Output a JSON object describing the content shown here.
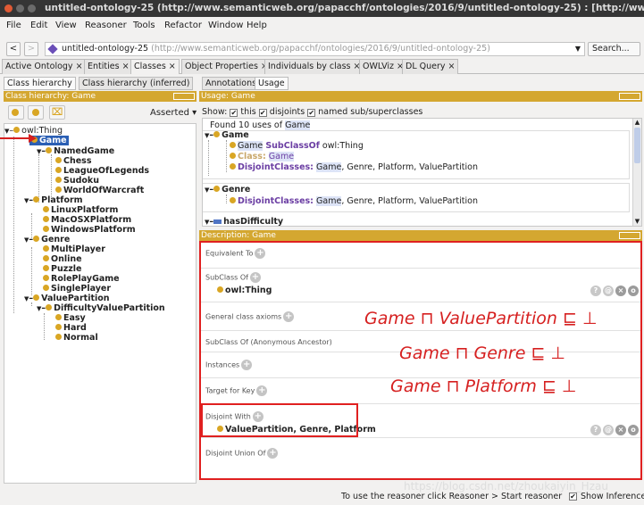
{
  "window": {
    "title": "untitled-ontology-25 (http://www.semanticweb.org/papacchf/ontologies/2016/9/untitled-ontology-25) : [http://www.semanticweb."
  },
  "menu": [
    "File",
    "Edit",
    "View",
    "Reasoner",
    "Tools",
    "Refactor",
    "Window",
    "Help"
  ],
  "urlbar": {
    "back": "<",
    "forward": ">",
    "ontology": "untitled-ontology-25",
    "iri": "(http://www.semanticweb.org/papacchf/ontologies/2016/9/untitled-ontology-25)",
    "search": "Search..."
  },
  "tabs": [
    "Active Ontology ×",
    "Entities ×",
    "Classes ×",
    "Object Properties ×",
    "Individuals by class ×",
    "OWLViz ×",
    "DL Query ×"
  ],
  "left": {
    "subtabs": [
      "Class hierarchy",
      "Class hierarchy (inferred)"
    ],
    "header": "Class hierarchy: Game",
    "asserted": "Asserted ▾",
    "tree": [
      "owl:Thing",
      "Game",
      "NamedGame",
      "Chess",
      "LeagueOfLegends",
      "Sudoku",
      "WorldOfWarcraft",
      "Platform",
      "LinuxPlatform",
      "MacOSXPlatform",
      "WindowsPlatform",
      "Genre",
      "MultiPlayer",
      "Online",
      "Puzzle",
      "RolePlayGame",
      "SinglePlayer",
      "ValuePartition",
      "DifficultyValuePartition",
      "Easy",
      "Hard",
      "Normal"
    ]
  },
  "right": {
    "subtabs": [
      "Annotations",
      "Usage"
    ],
    "usage_header": "Usage: Game",
    "show": "Show:",
    "opt_this": "this",
    "opt_disjoints": "disjoints",
    "opt_named": "named sub/superclasses",
    "found_prefix": "Found 10 uses of",
    "found_name": "Game",
    "usage": {
      "game": "Game",
      "l1_a": "Game",
      "l1_b": "SubClassOf",
      "l1_c": "owl:Thing",
      "l2_a": "Class:",
      "l2_b": "Game",
      "l3_a": "DisjointClasses:",
      "l3_b": "Game",
      "l3_c": ", Genre, Platform, ValuePartition",
      "genre": "Genre",
      "l4_a": "DisjointClasses:",
      "l4_b": "Game",
      "l4_c": ", Genre, Platform, ValuePartition",
      "next": "hasDifficulty"
    },
    "desc_header": "Description: Game",
    "sections": {
      "equivalent": "Equivalent To",
      "subclass": "SubClass Of",
      "subclass_value": "owl:Thing",
      "general": "General class axioms",
      "anonymous": "SubClass Of (Anonymous Ancestor)",
      "instances": "Instances",
      "target": "Target for Key",
      "disjoint": "Disjoint With",
      "disjoint_value": "ValuePartition, Genre, Platform",
      "disjoint_union": "Disjoint Union Of"
    }
  },
  "annotations": {
    "f1": "Game ⊓ ValuePartition ⊑ ⊥",
    "f2": "Game ⊓ Genre ⊑ ⊥",
    "f3": "Game ⊓ Platform ⊑ ⊥",
    "watermark": "https://blog.csdn.net/zhoukaiyin_Hzau",
    "color": "#d62020"
  },
  "status": {
    "text": "To use the reasoner click Reasoner > Start reasoner",
    "show_inferences": "Show Inferences"
  }
}
